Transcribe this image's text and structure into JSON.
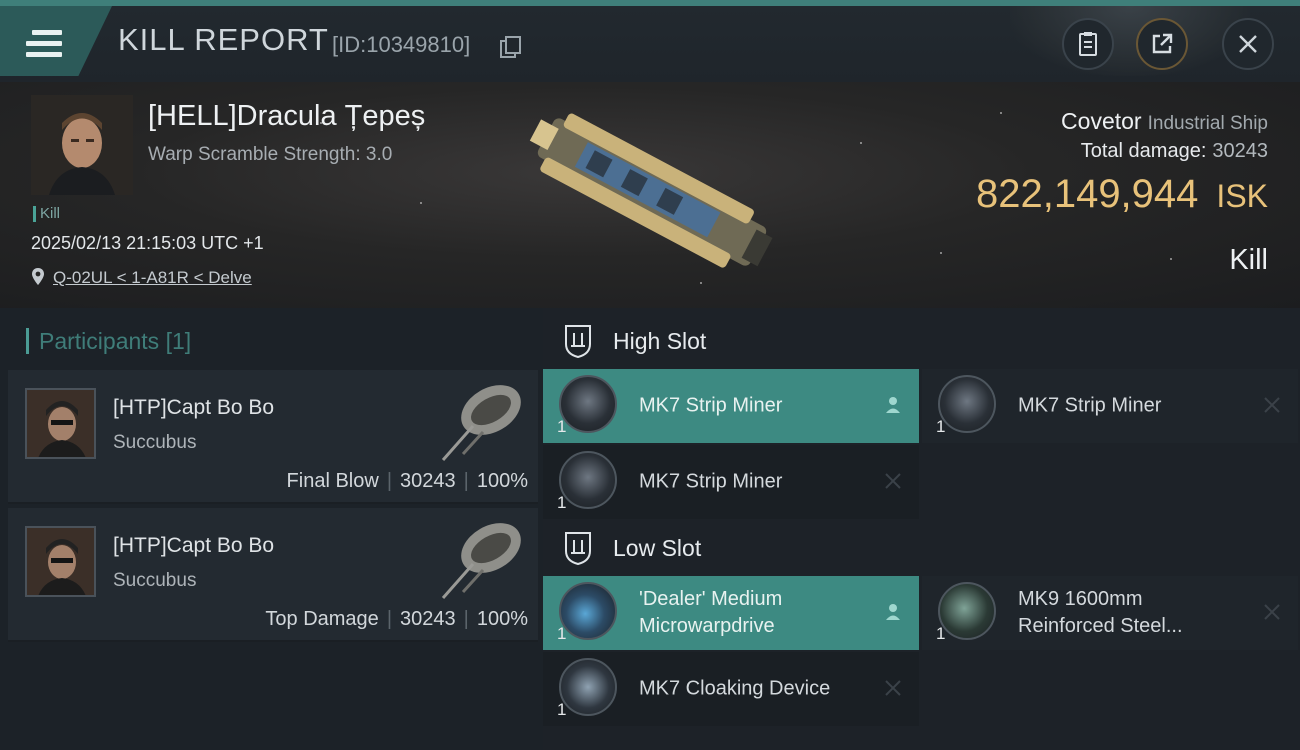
{
  "header": {
    "title": "KILL REPORT",
    "report_id": "[ID:10349810]",
    "icons": [
      "menu-icon",
      "copy-icon",
      "notes-icon",
      "share-icon",
      "close-icon"
    ]
  },
  "victim": {
    "name": "[HELL]Dracula Țepeș",
    "warp_scramble": "Warp Scramble Strength: 3.0",
    "badge": "Kill",
    "datetime": "2025/02/13 21:15:03 UTC +1",
    "location": "Q-02UL < 1-A81R < Delve"
  },
  "ship": {
    "name": "Covetor",
    "class": "Industrial Ship",
    "total_damage_label": "Total damage:",
    "total_damage": "30243",
    "isk_value": "822,149,944",
    "isk_unit": "ISK",
    "result": "Kill"
  },
  "participants": {
    "title": "Participants",
    "count": "[1]",
    "items": [
      {
        "name": "[HTP]Capt Bo Bo",
        "ship": "Succubus",
        "role": "Final Blow",
        "damage": "30243",
        "percent": "100%",
        "sep": "|"
      },
      {
        "name": "[HTP]Capt Bo Bo",
        "ship": "Succubus",
        "role": "Top Damage",
        "damage": "30243",
        "percent": "100%",
        "sep": "|"
      }
    ]
  },
  "slots": {
    "high": {
      "title": "High Slot",
      "modules": [
        {
          "name": "MK7 Strip Miner",
          "qty": "1",
          "state": "fitted"
        },
        {
          "name": "MK7 Strip Miner",
          "qty": "1",
          "state": "destroyed"
        },
        {
          "name": "MK7 Strip Miner",
          "qty": "1",
          "state": "destroyed"
        }
      ]
    },
    "low": {
      "title": "Low Slot",
      "modules": [
        {
          "name": "'Dealer' Medium Microwarpdrive",
          "line1": "'Dealer' Medium",
          "line2": "Microwarpdrive",
          "qty": "1",
          "state": "fitted"
        },
        {
          "name": "MK9 1600mm Reinforced Steel...",
          "line1": "MK9 1600mm",
          "line2": "Reinforced Steel...",
          "qty": "1",
          "state": "destroyed"
        },
        {
          "name": "MK7 Cloaking Device",
          "qty": "1",
          "state": "destroyed"
        }
      ]
    }
  },
  "colors": {
    "accent": "#3d8a82",
    "isk": "#e8c27a",
    "participants_header": "#3f7d79"
  }
}
